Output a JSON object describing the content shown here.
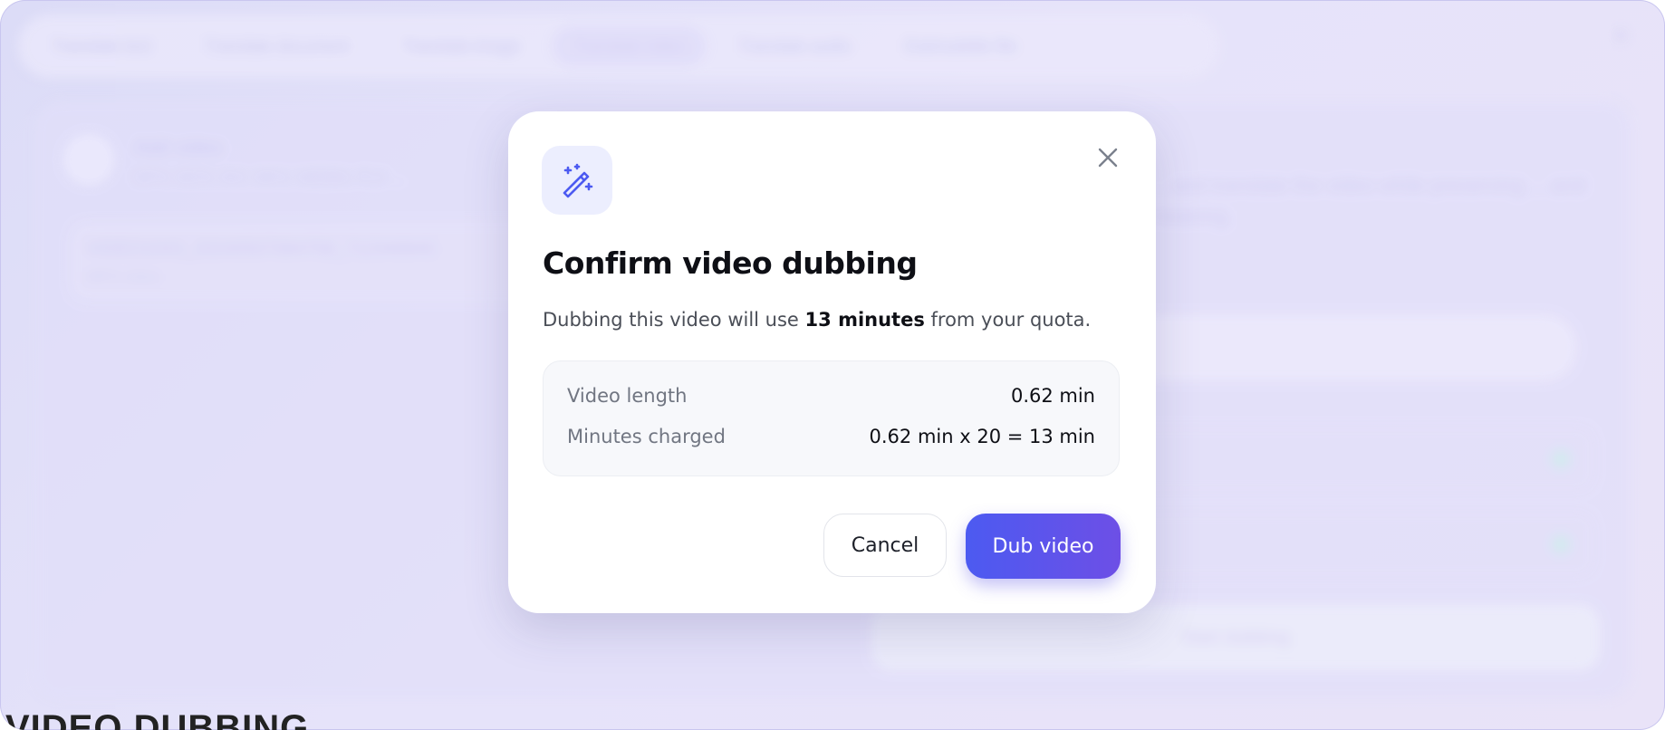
{
  "background": {
    "tabs": [
      "Translate text",
      "Translate document",
      "Translate image",
      "Translate video",
      "Translate audio",
      "Dub/subtitle file"
    ],
    "active_tab_index": 3,
    "upload_title": "Add video",
    "upload_hint": "MP4, MOV, AVI, MKV, WEBM, FLV ...",
    "file_name": "VIDEO1043_20240507084758_712340845",
    "file_type": "MP4 video",
    "right_text": "... and translate the video while preserving ... and meaning.",
    "start_button": "Start dubbing",
    "bottom_text": "VIDEO DUBBING"
  },
  "modal": {
    "title": "Confirm video dubbing",
    "desc_prefix": "Dubbing this video will use ",
    "desc_strong": "13 minutes",
    "desc_suffix": " from your quota.",
    "rows": [
      {
        "label": "Video length",
        "value": "0.62 min"
      },
      {
        "label": "Minutes charged",
        "value": "0.62 min x 20 = 13 min"
      }
    ],
    "cancel_label": "Cancel",
    "confirm_label": "Dub video",
    "icon": "magic-wand-icon",
    "accent_color": "#4c5af1"
  }
}
